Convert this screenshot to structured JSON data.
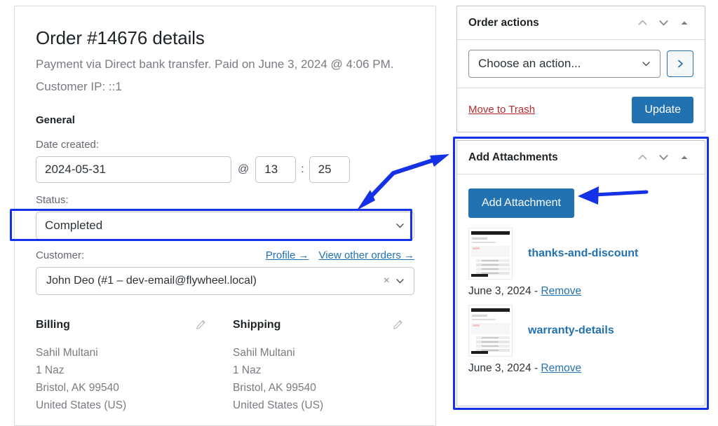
{
  "order": {
    "title": "Order #14676 details",
    "subtitle": "Payment via Direct bank transfer. Paid on June 3, 2024 @ 4:06 PM. Customer IP: ::1",
    "general_heading": "General",
    "date_label": "Date created:",
    "date_value": "2024-05-31",
    "at_symbol": "@",
    "hour_value": "13",
    "time_separator": ":",
    "minute_value": "25",
    "status_label": "Status:",
    "status_value": "Completed",
    "customer_label": "Customer:",
    "customer_value": "John Deo (#1 – dev-email@flywheel.local)",
    "clear_symbol": "×",
    "links": [
      {
        "label": "Profile →",
        "name": "profile-link"
      },
      {
        "label": "View other orders →",
        "name": "view-other-orders-link"
      }
    ]
  },
  "billing": {
    "title": "Billing",
    "lines": [
      "Sahil Multani",
      "1 Naz",
      "Bristol, AK 99540",
      "United States (US)"
    ]
  },
  "shipping": {
    "title": "Shipping",
    "lines": [
      "Sahil Multani",
      "1 Naz",
      "Bristol, AK 99540",
      "United States (US)"
    ]
  },
  "order_actions": {
    "title": "Order actions",
    "select_value": "Choose an action...",
    "go_label": "›",
    "trash_label": "Move to Trash",
    "update_label": "Update"
  },
  "add_attachments": {
    "title": "Add Attachments",
    "add_button_label": "Add Attachment",
    "items": [
      {
        "name": "thanks-and-discount",
        "date": "June 3, 2024 - ",
        "remove_label": "Remove"
      },
      {
        "name": "warranty-details",
        "date": "June 3, 2024 - ",
        "remove_label": "Remove"
      }
    ]
  },
  "annotations": {
    "highlight_color": "#1431e8",
    "arrow_color": "#1431e8",
    "accent_color": "#2271b1",
    "danger_color": "#b32d2e"
  }
}
